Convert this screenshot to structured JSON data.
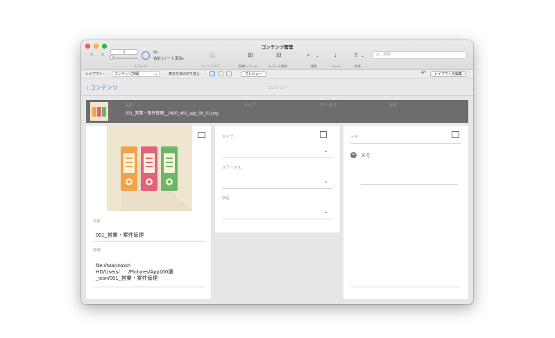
{
  "window": {
    "title": "コンテンツ管理"
  },
  "toolbar": {
    "record_number": "1",
    "found_count": "95",
    "found_total": "合計 (ソート済み)",
    "record_label": "レコード",
    "show_all_label": "すべてを表示",
    "new_record_label": "新規レコード",
    "delete_record_label": "レコード削除",
    "find_label": "検索",
    "sort_label": "ソート",
    "share_label": "共有",
    "search_placeholder": "検索"
  },
  "layoutbar": {
    "layout_label": "レイアウト:",
    "layout_value": "コンテンツ詳細",
    "view_as_label": "表示方法の切り替え:",
    "preview_label": "プレビュー",
    "font_size_label": "Aᴬ",
    "edit_layout_label": "レイアウトの編集"
  },
  "navbar": {
    "back_label": "コンテンツ",
    "title": "コンテンツ"
  },
  "header": {
    "name_caption": "名前",
    "type_caption": "タイプ",
    "status_caption": "ステータス",
    "location_caption": "所在",
    "filename": "001_営業・案件管理__0420_461_app_08_01.png"
  },
  "left": {
    "name_label": "名前",
    "name_value": "001_営業・案件管理",
    "detail_label": "詳細",
    "detail_line1": "file://Macintosh",
    "detail_line2": "HD/Users/      /Pictures/App100選",
    "detail_line3": "_icon/001_営業・案件管理"
  },
  "middle": {
    "type_label": "タイプ",
    "status_label": "ステータス",
    "location_label": "所在"
  },
  "right": {
    "memo_label": "メモ",
    "memo_item": "メモ"
  },
  "colors": {
    "accent": "#3b82f6",
    "binder_orange": "#f0a348",
    "binder_pink": "#e2617b",
    "binder_green": "#6cb669",
    "image_bg": "#efe6cf",
    "header_bg": "#6d6d6d"
  },
  "icons": [
    "back-chevron-icon",
    "forward-chevron-icon",
    "records-pie-icon",
    "show-all-icon",
    "new-record-icon",
    "delete-record-icon",
    "search-icon",
    "sort-icon",
    "share-icon",
    "image-icon",
    "duplicate-icon",
    "edit-note-icon",
    "delete-circle-icon",
    "dropdown-chevron-icon"
  ]
}
